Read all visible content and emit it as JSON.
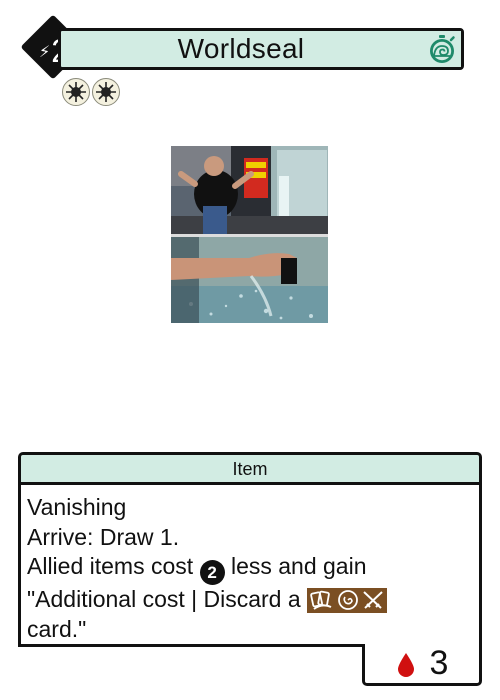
{
  "card": {
    "title": "Worldseal",
    "cost": "2",
    "speed_icon": "snail-stopwatch-icon",
    "symbols": [
      "sun-icon",
      "sun-icon"
    ],
    "art_description_icon": "artwork-image",
    "type": "Item",
    "rules": {
      "line1": "Vanishing",
      "line2": "Arrive: Draw 1.",
      "line3_pre": "Allied items cost",
      "line3_cost": "2",
      "line3_post": "less and gain",
      "line4_pre": "\"Additional cost | Discard a",
      "line5": "card.\""
    },
    "strength": "3",
    "strength_icon": "blood-drop-icon"
  },
  "colors": {
    "title_bg": "#d2ece3",
    "border": "#111111",
    "suit_badge": "#7b4f23",
    "blood": "#d01010"
  }
}
